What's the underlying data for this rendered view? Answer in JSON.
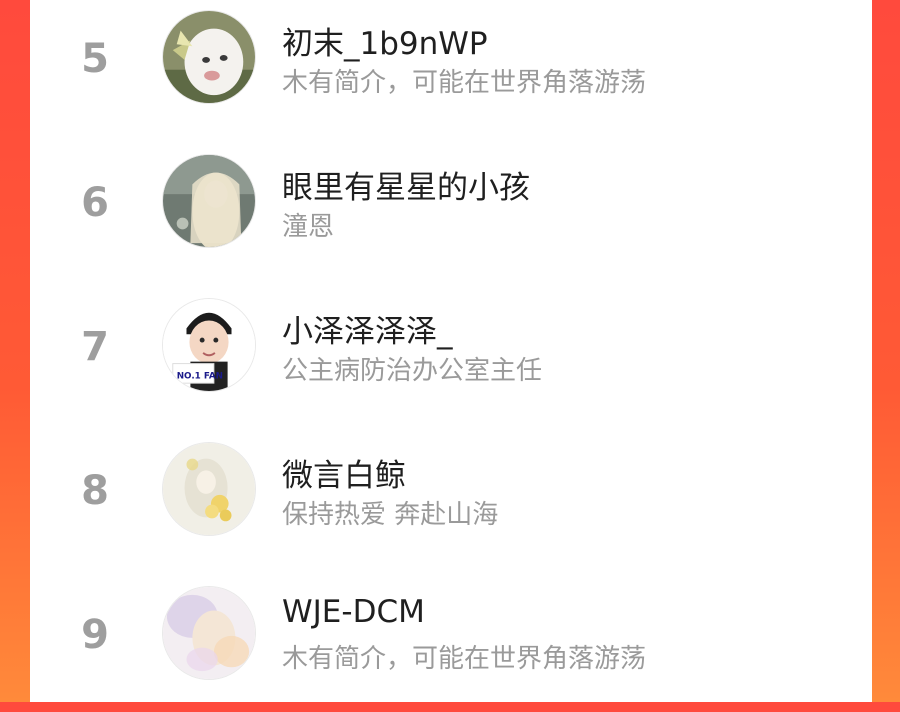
{
  "leaderboard": {
    "entries": [
      {
        "rank": "5",
        "name": "初末_1b9nWP",
        "bio": "木有简介，可能在世界角落游荡",
        "avatar_icon": "white-cat-avatar-icon"
      },
      {
        "rank": "6",
        "name": "眼里有星星的小孩",
        "bio": "潼恩",
        "avatar_icon": "illustrated-girl-avatar-icon"
      },
      {
        "rank": "7",
        "name": "小泽泽泽泽_",
        "bio": "公主病防治办公室主任",
        "avatar_icon": "cartoon-boy-avatar-icon",
        "avatar_text": "NO.1 FAN"
      },
      {
        "rank": "8",
        "name": "微言白鲸",
        "bio": "保持热爱 奔赴山海",
        "avatar_icon": "flower-girl-avatar-icon"
      },
      {
        "rank": "9",
        "name": "WJE-DCM",
        "bio": "木有简介，可能在世界角落游荡",
        "avatar_icon": "pastel-portrait-avatar-icon"
      }
    ]
  },
  "colors": {
    "background_gradient_top": "#ff4a3d",
    "background_gradient_bottom": "#ff8a3a",
    "rank_text": "#9e9e9e",
    "name_text": "#1f1f1f",
    "bio_text": "#9a9a9a"
  }
}
